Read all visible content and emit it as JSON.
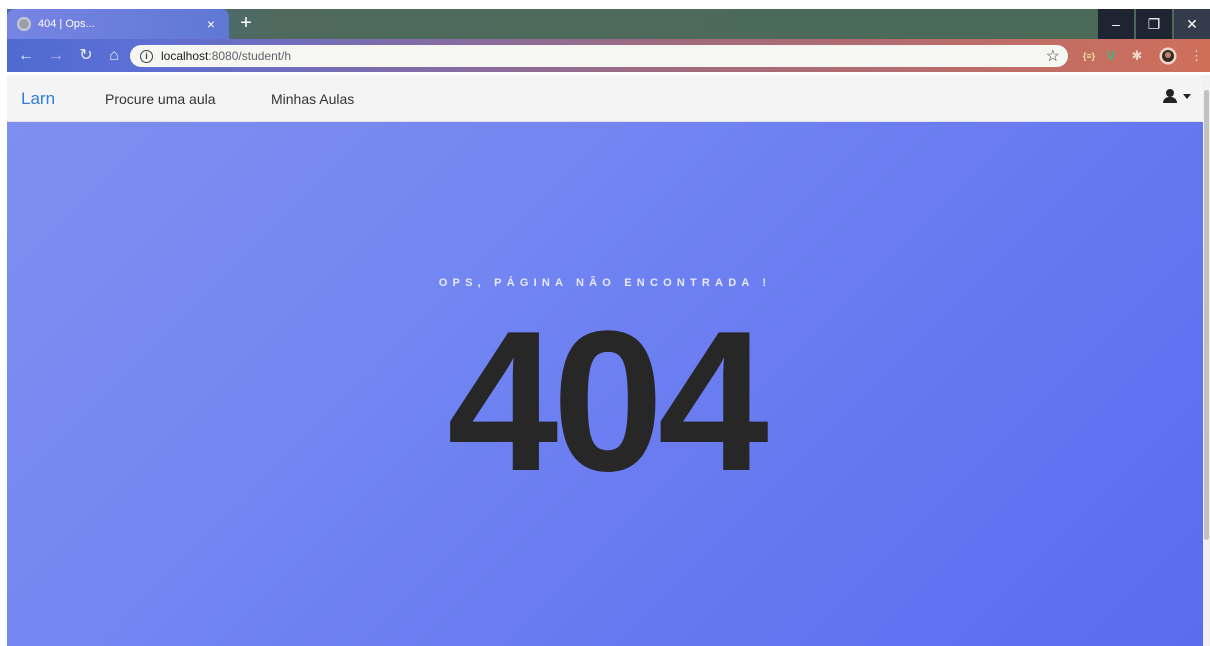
{
  "browser": {
    "tab_title": "404 | Ops...",
    "tab_close": "×",
    "new_tab": "+",
    "url_host": "localhost",
    "url_rest": ":8080/student/h",
    "window_controls": {
      "minimize": "–",
      "restore": "❐",
      "close": "✕"
    },
    "ext_badge": "{≡}",
    "ext_v": "V"
  },
  "navbar": {
    "brand": "Larn",
    "links": [
      "Procure uma aula",
      "Minhas Aulas"
    ]
  },
  "main": {
    "subtitle": "OPS, PÁGINA NÃO ENCONTRADA !",
    "code": "404"
  },
  "colors": {
    "brand": "#2f7ce0",
    "background_start": "#7e8ff0",
    "background_end": "#5a6cf0",
    "code_text": "#272727"
  }
}
